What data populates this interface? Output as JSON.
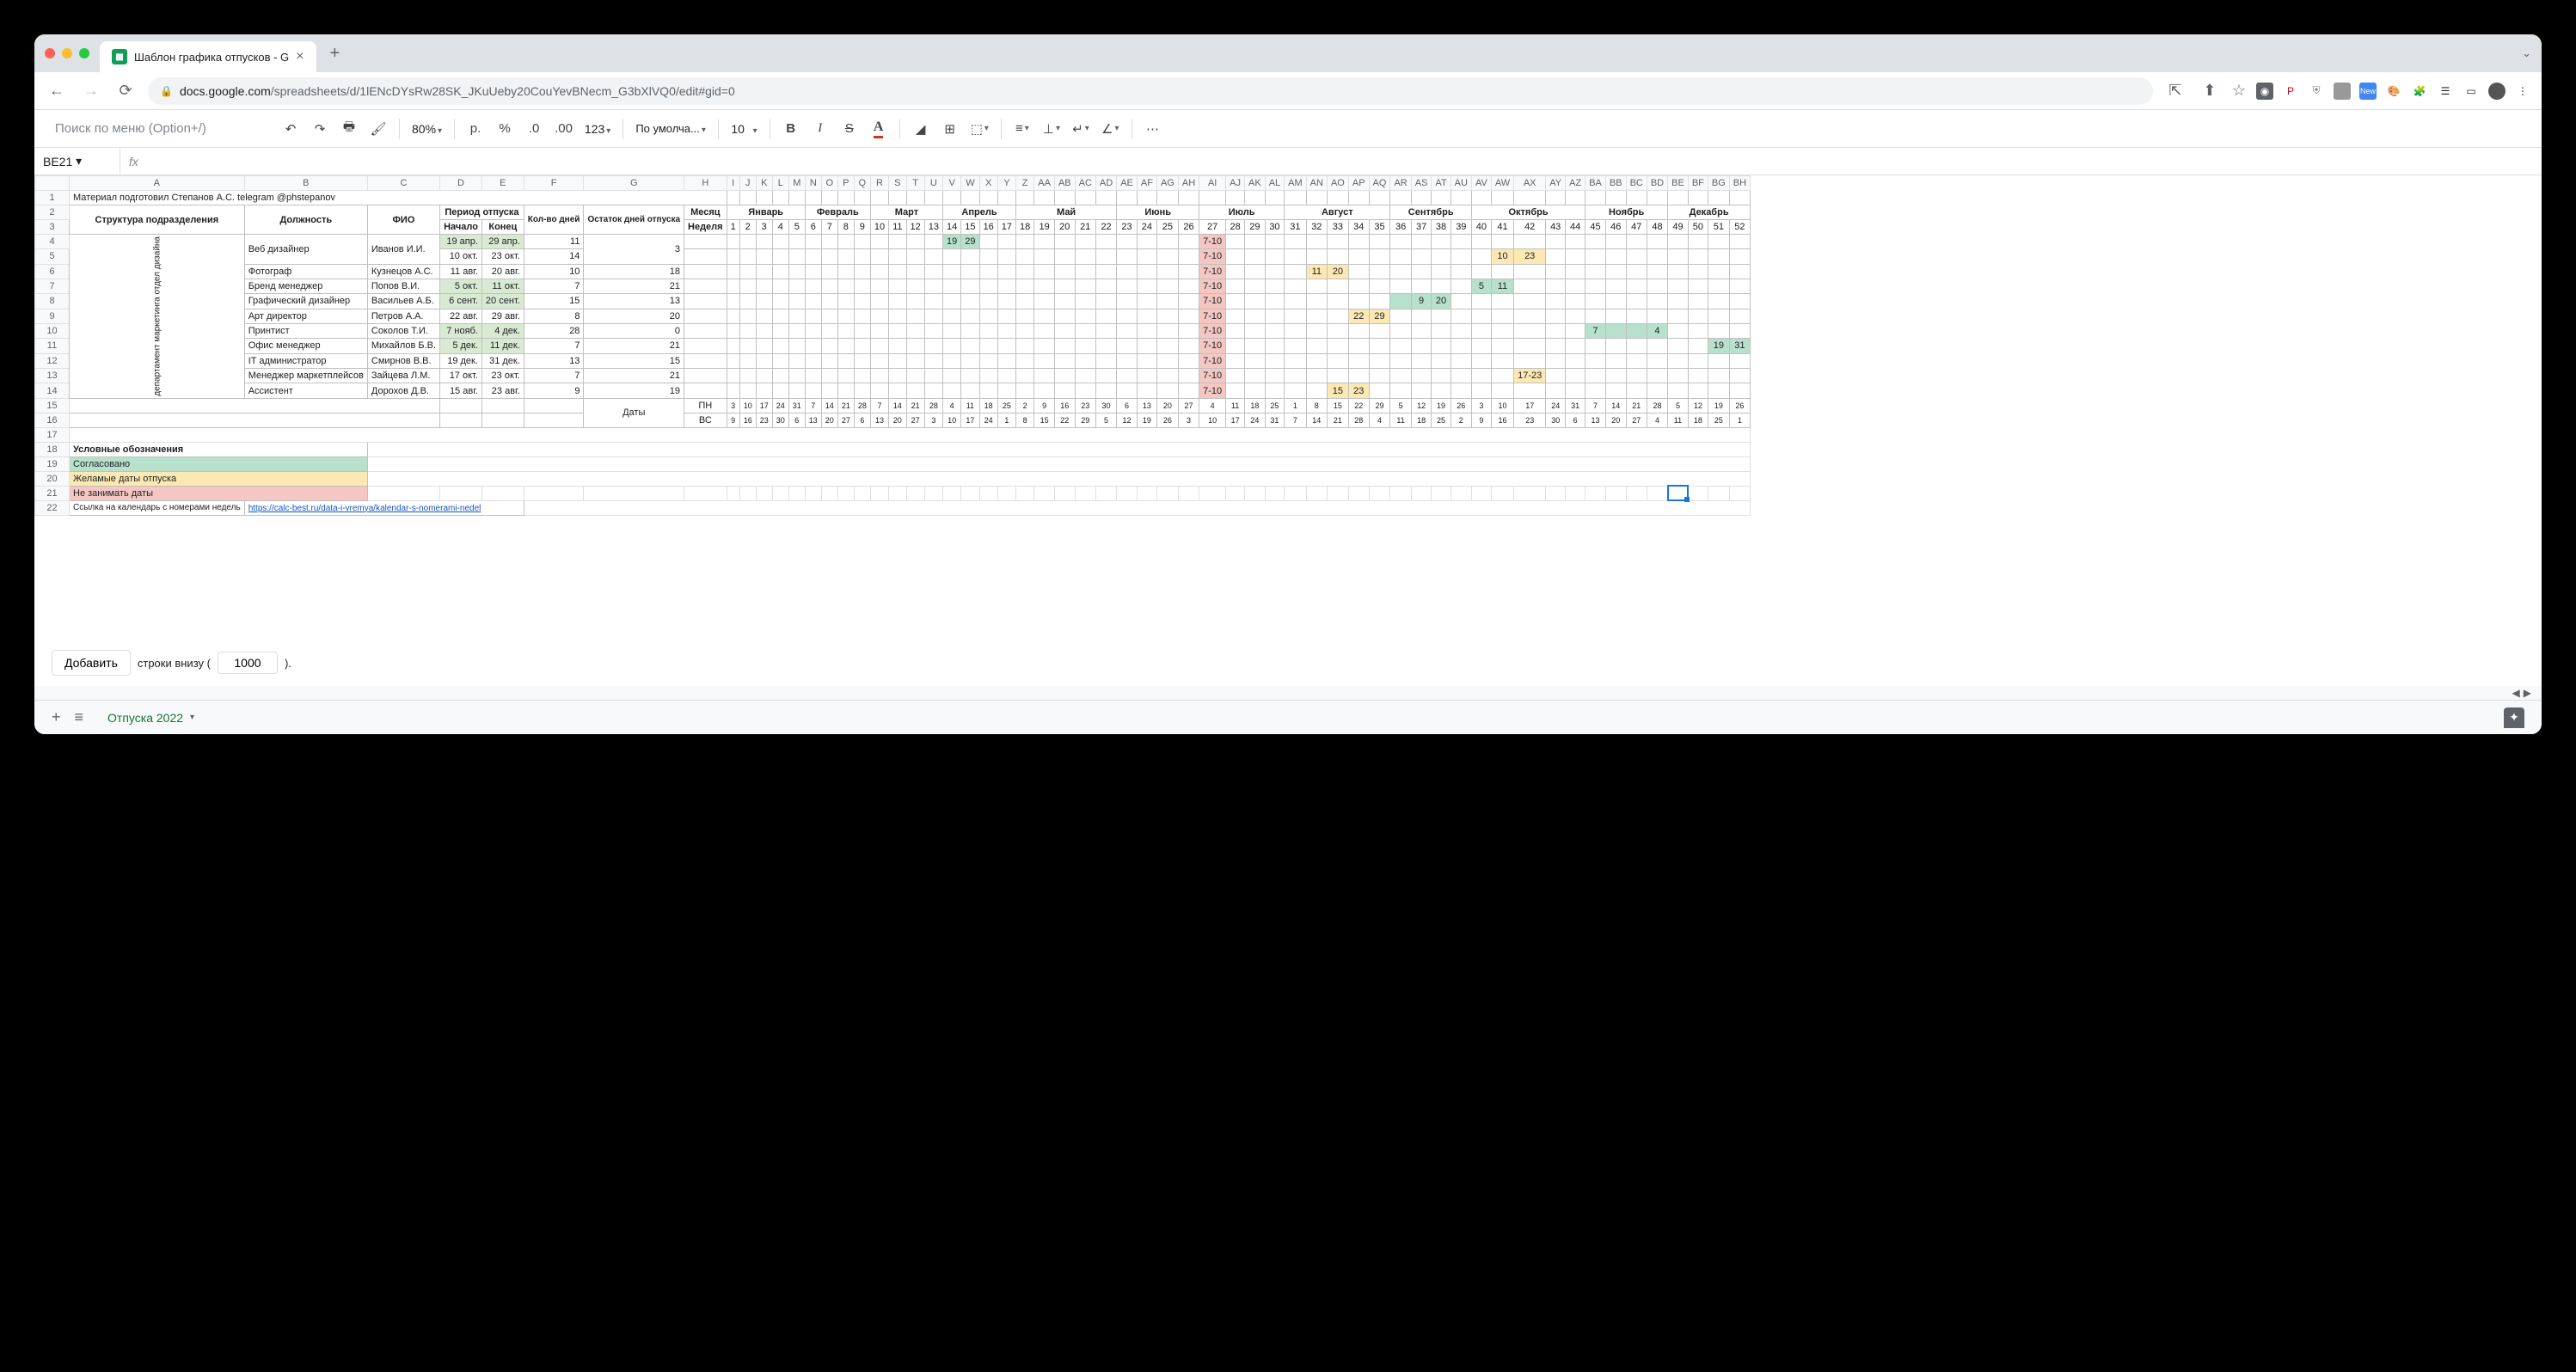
{
  "browser": {
    "tab_title": "Шаблон графика отпусков - G",
    "url_domain": "docs.google.com",
    "url_path": "/spreadsheets/d/1lENcDYsRw28SK_JKuUeby20CouYevBNecm_G3bXlVQ0/edit#gid=0"
  },
  "toolbar": {
    "menu_search": "Поиск по меню (Option+/)",
    "zoom": "80%",
    "currency": "р.",
    "font": "По умолча...",
    "font_size": "10"
  },
  "namebox": "BE21",
  "columns": [
    "A",
    "B",
    "C",
    "D",
    "E",
    "F",
    "G",
    "H",
    "I",
    "J",
    "K",
    "L",
    "M",
    "N",
    "O",
    "P",
    "Q",
    "R",
    "S",
    "T",
    "U",
    "V",
    "W",
    "X",
    "Y",
    "Z",
    "AA",
    "AB",
    "AC",
    "AD",
    "AE",
    "AF",
    "AG",
    "AH",
    "AI",
    "AJ",
    "AK",
    "AL",
    "AM",
    "AN",
    "AO",
    "AP",
    "AQ",
    "AR",
    "AS",
    "AT",
    "AU",
    "AV",
    "AW",
    "AX",
    "AY",
    "AZ",
    "BA",
    "BB",
    "BC",
    "BD",
    "BE",
    "BF",
    "BG",
    "BH"
  ],
  "row_numbers": [
    1,
    2,
    3,
    4,
    5,
    6,
    7,
    8,
    9,
    10,
    11,
    12,
    13,
    14,
    15,
    16,
    17,
    18,
    19,
    20,
    21,
    22
  ],
  "header_text": "Материал подготовил Степанов А.С. telegram @phstepanov",
  "table_headers": {
    "structure": "Структура подразделения",
    "position": "Должность",
    "name": "ФИО",
    "period": "Период отпуска",
    "start": "Начало",
    "end": "Конец",
    "days": "Кол-во дней",
    "remaining": "Остаток дней отпуска",
    "month": "Месяц",
    "week": "Неделя",
    "months": [
      "Январь",
      "Февраль",
      "Март",
      "Апрель",
      "Май",
      "Июнь",
      "Июль",
      "Август",
      "Сентябрь",
      "Октябрь",
      "Ноябрь",
      "Декабрь"
    ],
    "dates": "Даты",
    "mon": "ПН",
    "sun": "ВС"
  },
  "department": "департамент маркетинга отдел дизайна",
  "weeks": [
    1,
    2,
    3,
    4,
    5,
    6,
    7,
    8,
    9,
    10,
    11,
    12,
    13,
    14,
    15,
    16,
    17,
    18,
    19,
    20,
    21,
    22,
    23,
    24,
    25,
    26,
    27,
    28,
    29,
    30,
    31,
    32,
    33,
    34,
    35,
    36,
    37,
    38,
    39,
    40,
    41,
    42,
    43,
    44,
    45,
    46,
    47,
    48,
    49,
    50,
    51,
    52
  ],
  "employees": [
    {
      "position": "Веб дизайнер",
      "name": "Иванов И.И.",
      "start": "19 апр.",
      "end": "29 апр.",
      "days": 11,
      "remaining": 3,
      "green": [
        14,
        15
      ],
      "red": "7-10"
    },
    {
      "position": "",
      "name": "",
      "start": "10 окт.",
      "end": "23 окт.",
      "days": 14,
      "remaining": "",
      "red": "7-10",
      "yellow": [
        41,
        42
      ],
      "yv": [
        "10",
        "23"
      ]
    },
    {
      "position": "Фотограф",
      "name": "Кузнецов А.С.",
      "start": "11 авг.",
      "end": "20 авг.",
      "days": 10,
      "remaining": 18,
      "red": "7-10",
      "yellow": [
        32,
        33
      ],
      "yv": [
        "11",
        "20"
      ]
    },
    {
      "position": "Бренд менеджер",
      "name": "Попов В.И.",
      "start": "5 окт.",
      "end": "11 окт.",
      "days": 7,
      "remaining": 21,
      "red": "7-10",
      "green2": [
        40,
        41
      ],
      "gv": [
        "5",
        "11"
      ]
    },
    {
      "position": "Графический дизайнер",
      "name": "Васильев А.Б.",
      "start": "6 сент.",
      "end": "20 сент.",
      "days": 15,
      "remaining": 13,
      "red": "7-10",
      "green2": [
        36,
        37,
        38
      ],
      "gv": [
        "",
        "9",
        "20"
      ]
    },
    {
      "position": "Арт директор",
      "name": "Петров А.А.",
      "start": "22 авг.",
      "end": "29 авг.",
      "days": 8,
      "remaining": 20,
      "red": "7-10",
      "yellow": [
        34,
        35
      ],
      "yv": [
        "22",
        "29"
      ]
    },
    {
      "position": "Принтист",
      "name": "Соколов Т.И.",
      "start": "7 нояб.",
      "end": "4 дек.",
      "days": 28,
      "remaining": 0,
      "red": "7-10",
      "green2": [
        45,
        46,
        47,
        48
      ],
      "gv": [
        "7",
        "",
        "",
        "4"
      ]
    },
    {
      "position": "Офис менеджер",
      "name": "Михайлов Б.В.",
      "start": "5 дек.",
      "end": "11 дек.",
      "days": 7,
      "remaining": 21,
      "red": "7-10",
      "green2": [
        51,
        52
      ],
      "gv": [
        "19",
        "31"
      ]
    },
    {
      "position": "IT администратор",
      "name": "Смирнов В.В.",
      "start": "19 дек.",
      "end": "31 дек.",
      "days": 13,
      "remaining": 15,
      "red": "7-10"
    },
    {
      "position": "Менеджер маркетплейсов",
      "name": "Зайцева Л.М.",
      "start": "17 окт.",
      "end": "23 окт.",
      "days": 7,
      "remaining": 21,
      "red": "7-10",
      "yellow2": [
        42
      ],
      "yv2": "17-23"
    },
    {
      "position": "Ассистент",
      "name": "Дорохов Д.В.",
      "start": "15 авг.",
      "end": "23 авг.",
      "days": 9,
      "remaining": 19,
      "red": "7-10",
      "yellow": [
        33,
        34
      ],
      "yv": [
        "15",
        "23"
      ]
    }
  ],
  "mon_dates": [
    3,
    10,
    17,
    24,
    31,
    7,
    14,
    21,
    28,
    7,
    14,
    21,
    28,
    4,
    11,
    18,
    25,
    2,
    9,
    16,
    23,
    30,
    6,
    13,
    20,
    27,
    4,
    11,
    18,
    25,
    1,
    8,
    15,
    22,
    29,
    5,
    12,
    19,
    26,
    3,
    10,
    17,
    24,
    31,
    7,
    14,
    21,
    28,
    5,
    12,
    19,
    26
  ],
  "sun_dates": [
    9,
    16,
    23,
    30,
    6,
    13,
    20,
    27,
    6,
    13,
    20,
    27,
    3,
    10,
    17,
    24,
    1,
    8,
    15,
    22,
    29,
    5,
    12,
    19,
    26,
    3,
    10,
    17,
    24,
    31,
    7,
    14,
    21,
    28,
    4,
    11,
    18,
    25,
    2,
    9,
    16,
    23,
    30,
    6,
    13,
    20,
    27,
    4,
    11,
    18,
    25,
    1
  ],
  "legend": {
    "title": "Условные обозначения",
    "agreed": "Согласовано",
    "desired": "Желамые даты отпуска",
    "blocked": "Не занимать даты",
    "link_label": "Ссылка на календарь с номерами недель",
    "link_url": "https://calc-best.ru/data-i-vremya/kalendar-s-nomerami-nedel"
  },
  "addrow": {
    "button": "Добавить",
    "text1": "строки внизу (",
    "value": "1000",
    "text2": ")."
  },
  "sheet_tab": "Отпуска 2022"
}
